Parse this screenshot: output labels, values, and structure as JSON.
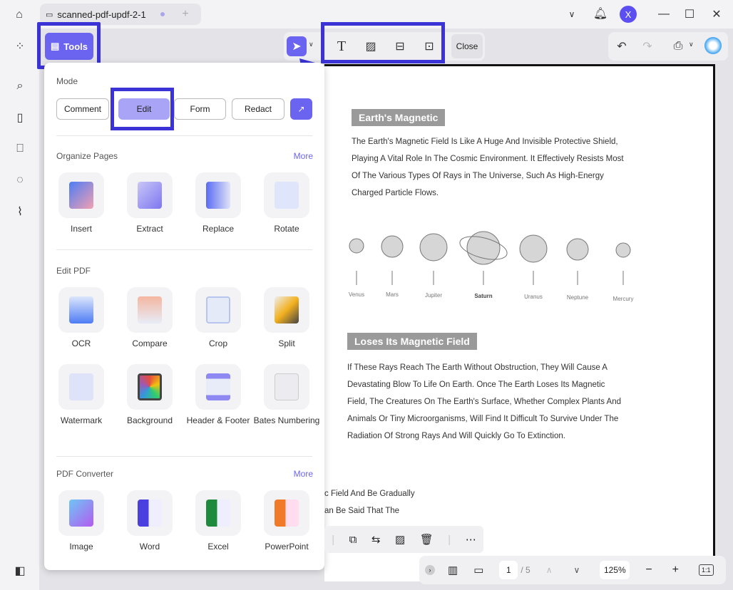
{
  "tab": {
    "title": "scanned-pdf-updf-2-1"
  },
  "user": {
    "initial": "X"
  },
  "toolbar": {
    "tools_label": "Tools",
    "close_label": "Close"
  },
  "panel": {
    "mode_label": "Mode",
    "modes": [
      "Comment",
      "Edit",
      "Form",
      "Redact"
    ],
    "organize": {
      "title": "Organize Pages",
      "more": "More",
      "items": [
        "Insert",
        "Extract",
        "Replace",
        "Rotate"
      ]
    },
    "edit": {
      "title": "Edit PDF",
      "items": [
        "OCR",
        "Compare",
        "Crop",
        "Split",
        "Watermark",
        "Background",
        "Header & Footer",
        "Bates Numbering"
      ]
    },
    "converter": {
      "title": "PDF Converter",
      "more": "More",
      "items": [
        "Image",
        "Word",
        "Excel",
        "PowerPoint"
      ]
    }
  },
  "document": {
    "heading1": "Earth's Magnetic",
    "para1": [
      "The Earth's Magnetic Field Is Like A Huge And Invisible Protective Shield,",
      "Playing A Vital Role In The Cosmic Environment. It Effectively Resists Most",
      "Of The Various Types Of Rays in The Universe, Such As High-Energy",
      "Charged Particle Flows."
    ],
    "planets": [
      "Venus",
      "Mars",
      "Jupiter",
      "Saturn",
      "Uranus",
      "Neptune",
      "Mercury"
    ],
    "heading2": "Loses Its Magnetic Field",
    "para2": [
      "If These Rays Reach The Earth Without Obstruction, They Will Cause A",
      "Devastating Blow To Life On Earth. Once The Earth Loses Its Magnetic",
      "Field, The Creatures On The Earth's Surface, Whether Complex Plants And",
      "Animals Or Tiny Microorganisms, Will Find It Difficult To Survive Under The",
      "Radiation Of Strong Rays And Will Quickly Go To Extinction."
    ],
    "para3": [
      "c Field And Be Gradually",
      "an Be Said That The"
    ]
  },
  "pager": {
    "current": "1",
    "total": "/ 5",
    "zoom": "125%",
    "fit": "1:1"
  },
  "colors": {
    "accent": "#6b64f0",
    "highlight": "#3b33d6"
  }
}
